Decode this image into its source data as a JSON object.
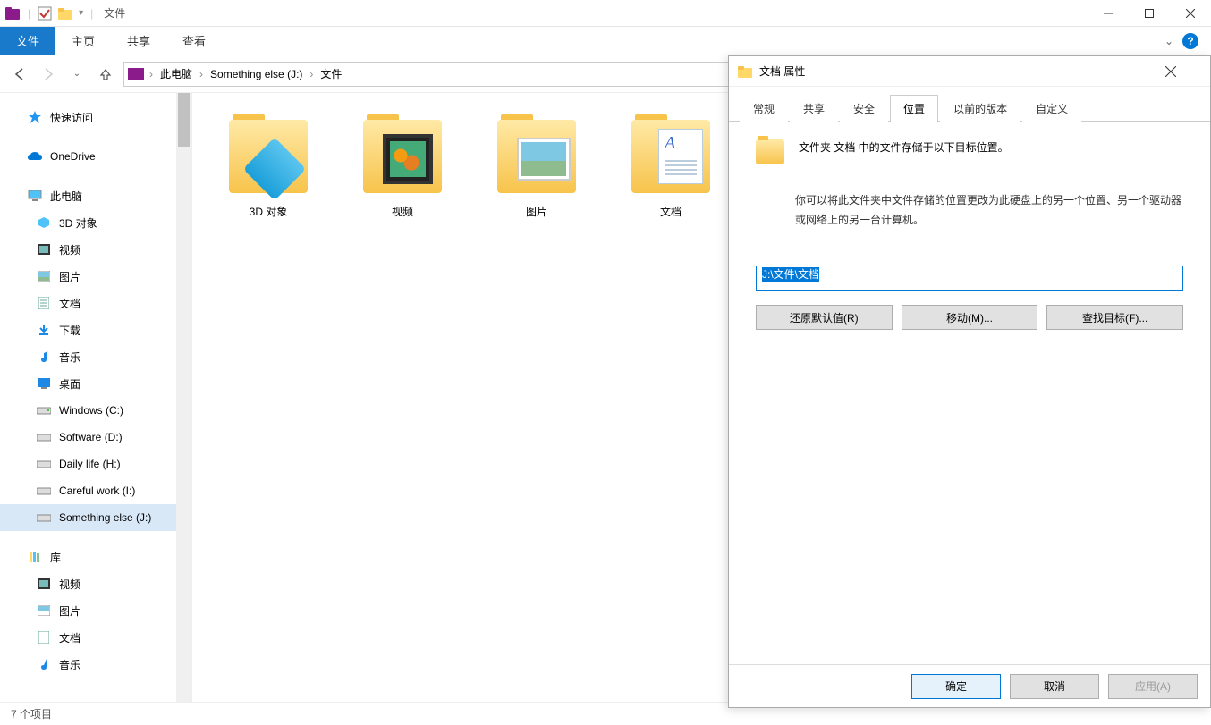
{
  "window": {
    "title": "文件",
    "minimize": "─",
    "maximize": "☐",
    "close": "✕"
  },
  "ribbon": {
    "file": "文件",
    "home": "主页",
    "share": "共享",
    "view": "查看",
    "expand": "⌄",
    "help": "?"
  },
  "nav": {
    "back": "←",
    "forward": "→",
    "up": "↑",
    "dropdown": "⌄"
  },
  "breadcrumb": {
    "items": [
      "此电脑",
      "Something else (J:)",
      "文件"
    ],
    "chev": "›"
  },
  "tree": {
    "quick_access": "快速访问",
    "onedrive": "OneDrive",
    "this_pc": "此电脑",
    "objects_3d": "3D 对象",
    "videos": "视频",
    "pictures": "图片",
    "documents": "文档",
    "downloads": "下载",
    "music": "音乐",
    "desktop": "桌面",
    "drive_c": "Windows (C:)",
    "drive_d": "Software (D:)",
    "drive_h": "Daily life (H:)",
    "drive_i": "Careful work (I:)",
    "drive_j": "Something else (J:)",
    "libraries": "库",
    "lib_videos": "视频",
    "lib_pictures": "图片",
    "lib_documents": "文档",
    "lib_music": "音乐"
  },
  "items": {
    "objects_3d": "3D 对象",
    "videos": "视频",
    "pictures": "图片",
    "documents": "文档"
  },
  "statusbar": {
    "count": "7 个项目"
  },
  "dialog": {
    "title": "文档 属性",
    "close": "✕",
    "tabs": {
      "general": "常规",
      "share": "共享",
      "security": "安全",
      "location": "位置",
      "previous": "以前的版本",
      "custom": "自定义"
    },
    "intro": "文件夹 文档 中的文件存储于以下目标位置。",
    "desc": "你可以将此文件夹中文件存储的位置更改为此硬盘上的另一个位置、另一个驱动器或网络上的另一台计算机。",
    "path": "J:\\文件\\文档",
    "restore": "还原默认值(R)",
    "move": "移动(M)...",
    "find": "查找目标(F)...",
    "ok": "确定",
    "cancel": "取消",
    "apply": "应用(A)"
  }
}
